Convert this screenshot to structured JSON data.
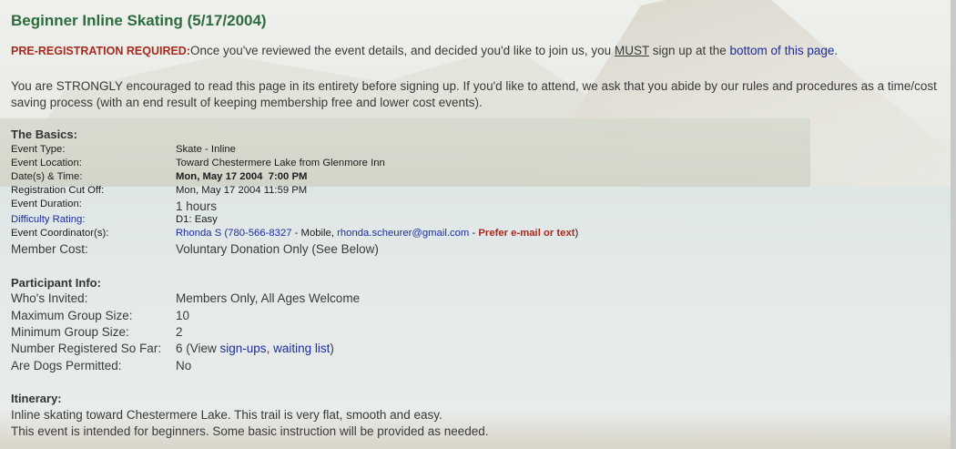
{
  "page_title": "Beginner Inline Skating (5/17/2004)",
  "intro": {
    "req_label": "PRE-REGISTRATION REQUIRED:",
    "text_a": "Once you've reviewed the event details, and decided you'd like to join us, you ",
    "must": "MUST",
    "text_b": " sign up at the ",
    "link": "bottom of this page",
    "text_c": "."
  },
  "paragraph": "You are STRONGLY encouraged to read this page in its entirety before signing up. If you'd like to attend, we ask that you abide by our rules and procedures as a time/cost saving process (with an end result of keeping membership free and lower cost events).",
  "basics": {
    "heading": "The Basics:",
    "event_type": {
      "label": "Event Type:",
      "value": "Skate - Inline"
    },
    "location": {
      "label": "Event Location:",
      "value": "Toward Chestermere Lake from Glenmore Inn"
    },
    "datetime": {
      "label": "Date(s) & Time:",
      "value": "Mon, May 17 2004  7:00 PM"
    },
    "cutoff": {
      "label": "Registration Cut Off:",
      "value": "Mon, May 17 2004 11:59 PM"
    },
    "duration": {
      "label": "Event Duration:",
      "value": "1 hours"
    },
    "difficulty": {
      "label": "Difficulty Rating:",
      "value": "D1: Easy"
    },
    "coordinator": {
      "label": "Event Coordinator(s):",
      "name": "Rhonda S",
      "open": " (",
      "phone": "780-566-8327",
      "mid": " - Mobile, ",
      "email": "rhonda.scheurer@gmail.com",
      "sep": " - ",
      "pref": "Prefer e-mail or text",
      "close": ")"
    },
    "cost": {
      "label": "Member Cost:",
      "value": "Voluntary Donation Only (See Below)"
    }
  },
  "participant": {
    "heading": "Participant Info:",
    "invited": {
      "label": "Who's Invited:",
      "value": "Members Only, All Ages Welcome"
    },
    "max": {
      "label": "Maximum Group Size:",
      "value": "10"
    },
    "min": {
      "label": "Minimum Group Size:",
      "value": "2"
    },
    "registered": {
      "label": "Number Registered So Far:",
      "count": "6 (View ",
      "signups": "sign-ups",
      "comma": ", ",
      "waiting": "waiting list",
      "close": ")"
    },
    "dogs": {
      "label": "Are Dogs Permitted:",
      "value": "No"
    }
  },
  "itinerary": {
    "heading": "Itinerary:",
    "line1": "Inline skating toward Chestermere Lake. This trail is very flat, smooth and easy.",
    "line2": "This event is intended for beginners. Some basic instruction will be provided as needed."
  }
}
